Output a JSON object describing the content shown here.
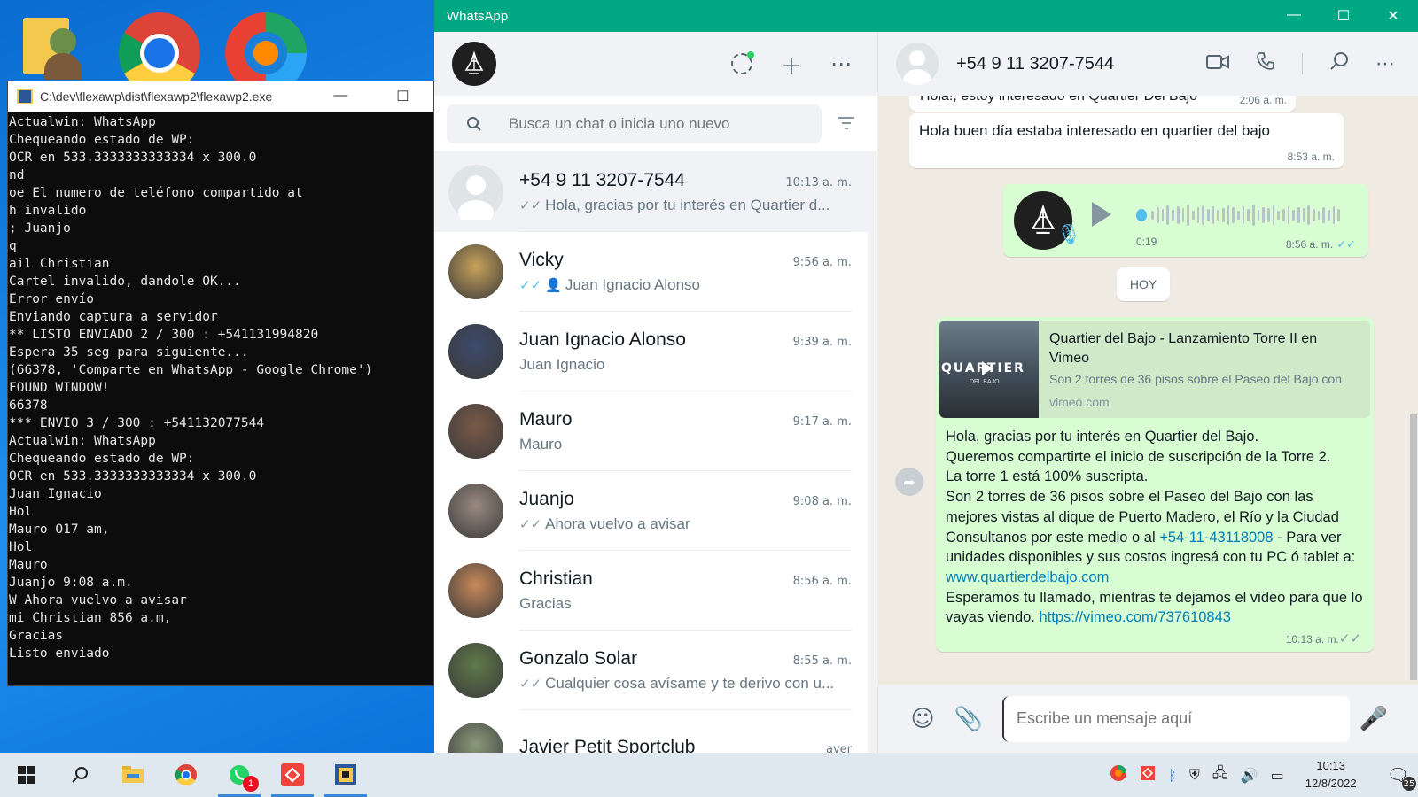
{
  "console": {
    "title": "C:\\dev\\flexawp\\dist\\flexawp2\\flexawp2.exe",
    "minimize": "—",
    "maximize": "☐",
    "lines": [
      "Actualwin: WhatsApp",
      "Chequeando estado de WP:",
      "OCR en 533.3333333333334 x 300.0",
      "nd",
      "oe El numero de teléfono compartido at",
      "h invalido",
      "; Juanjo",
      "q",
      "ail Christian",
      "Cartel invalido, dandole OK...",
      "Error envío",
      "Enviando captura a servidor",
      "** LISTO ENVIADO 2 / 300 : +541131994820",
      "Espera 35 seg para siguiente...",
      "(66378, 'Comparte en WhatsApp - Google Chrome')",
      "FOUND WINDOW!",
      "66378",
      "*** ENVIO 3 / 300 : +541132077544",
      "Actualwin: WhatsApp",
      "Chequeando estado de WP:",
      "OCR en 533.3333333333334 x 300.0",
      "Juan Ignacio",
      "Hol",
      "Mauro O17 am,",
      "Hol",
      "Mauro",
      "Juanjo 9:08 a.m.",
      "W Ahora vuelvo a avisar",
      "mi Christian 856 a.m,",
      "Gracias",
      "Listo enviado"
    ]
  },
  "whatsapp": {
    "window_title": "WhatsApp",
    "window_controls": {
      "minimize": "—",
      "maximize": "☐",
      "close": "✕"
    },
    "search": {
      "placeholder": "Busca un chat o inicia uno nuevo"
    },
    "chats": [
      {
        "name": "+54 9 11 3207-7544",
        "time": "10:13 a. m.",
        "preview": "Hola, gracias por tu interés en Quartier d...",
        "tick": "grey",
        "active": true,
        "avatar": "default"
      },
      {
        "name": "Vicky",
        "time": "9:56 a. m.",
        "preview": "Juan Ignacio Alonso",
        "tick": "blue",
        "contact_icon": true,
        "avatar_color": "#c8a25a"
      },
      {
        "name": "Juan Ignacio Alonso",
        "time": "9:39 a. m.",
        "preview": "Juan Ignacio",
        "tick": "none",
        "avatar_color": "#3d4a6b"
      },
      {
        "name": "Mauro",
        "time": "9:17 a. m.",
        "preview": "Mauro",
        "tick": "none",
        "avatar_color": "#7a5a48"
      },
      {
        "name": "Juanjo",
        "time": "9:08 a. m.",
        "preview": "Ahora vuelvo a avisar",
        "tick": "grey",
        "avatar_color": "#9a8a80"
      },
      {
        "name": "Christian",
        "time": "8:56 a. m.",
        "preview": "Gracias",
        "tick": "none",
        "avatar_color": "#c9895a"
      },
      {
        "name": "Gonzalo Solar",
        "time": "8:55 a. m.",
        "preview": "Cualquier cosa avísame y te derivo con u...",
        "tick": "grey",
        "avatar_color": "#5f7a4a"
      },
      {
        "name": "Javier Petit Sportclub",
        "time": "ayer",
        "preview": "",
        "tick": "none",
        "avatar_color": "#8a9a7a"
      }
    ],
    "conversation": {
      "contact": "+54 9 11 3207-7544",
      "messages": {
        "partial_text": "Hola!, estoy interesado en Quartier Del Bajo",
        "partial_time": "2:06 a. m.",
        "text_in": "Hola buen día estaba interesado en quartier del bajo",
        "text_in_time": "8:53 a. m.",
        "voice_duration": "0:19",
        "voice_time": "8:56 a. m.",
        "day_chip": "HOY",
        "link_preview_title": "Quartier del Bajo - Lanzamiento Torre II en Vimeo",
        "link_preview_desc": "Son 2 torres de 36 pisos sobre el Paseo del Bajo con",
        "link_preview_domain": "vimeo.com",
        "thumb_text": "QUARTIER",
        "thumb_sub": "DEL BAJO",
        "body_1": "Hola, gracias por tu interés en Quartier del Bajo.",
        "body_2": "Queremos compartirte el inicio de suscripción de la Torre 2.",
        "body_3": "La torre 1 está 100% suscripta.",
        "body_4": "Son 2 torres de 36 pisos sobre el Paseo del Bajo con las mejores vistas al dique de Puerto Madero, el Río y la Ciudad",
        "body_5a": "Consultanos por este medio o al ",
        "body_5_phone": "+54-11-43118008",
        "body_5b": " - Para ver unidades disponibles y sus costos ingresá con tu PC ó tablet a: ",
        "body_5_url": "www.quartierdelbajo.com",
        "body_6a": "Esperamos tu llamado, mientras te dejamos el video para que lo vayas viendo. ",
        "body_6_url": "https://vimeo.com/737610843",
        "out_time": "10:13 a. m."
      },
      "composer_placeholder": "Escribe un mensaje aquí"
    }
  },
  "taskbar": {
    "whatsapp_badge": "1",
    "clock_time": "10:13",
    "clock_date": "12/8/2022",
    "notifications_count": "25"
  },
  "colors": {
    "whatsapp_green": "#00a884",
    "outgoing_bubble": "#d9fdd3",
    "read_tick": "#53bdeb",
    "link": "#027eb5"
  }
}
